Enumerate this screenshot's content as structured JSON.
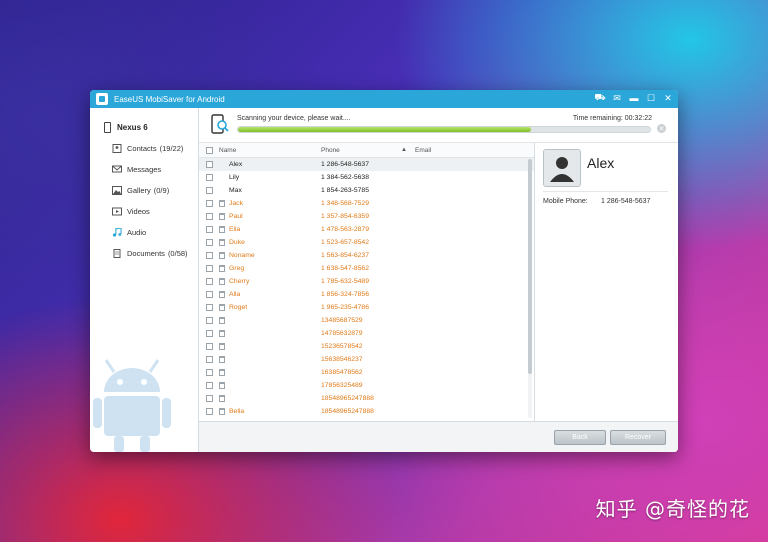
{
  "window": {
    "title": "EaseUS MobiSaver for Android"
  },
  "sidebar": {
    "device": "Nexus 6",
    "items": [
      {
        "label": "Contacts",
        "count": "(19/22)",
        "icon": "contacts-icon"
      },
      {
        "label": "Messages",
        "count": "",
        "icon": "messages-icon"
      },
      {
        "label": "Gallery",
        "count": "(0/9)",
        "icon": "gallery-icon"
      },
      {
        "label": "Videos",
        "count": "",
        "icon": "videos-icon"
      },
      {
        "label": "Audio",
        "count": "",
        "icon": "audio-icon"
      },
      {
        "label": "Documents",
        "count": "(0/58)",
        "icon": "documents-icon"
      }
    ]
  },
  "scan": {
    "status": "Scanning your device, please wait....",
    "remaining_label": "Time remaining: 00:32:22",
    "progress_percent": 71
  },
  "table": {
    "headers": {
      "name": "Name",
      "phone": "Phone",
      "email": "Email"
    },
    "rows": [
      {
        "name": "Alex",
        "phone": "1 286-548-5637",
        "deleted": false,
        "selected": true
      },
      {
        "name": "Lily",
        "phone": "1 384-562-5638",
        "deleted": false
      },
      {
        "name": "Max",
        "phone": "1 854-263-5785",
        "deleted": false
      },
      {
        "name": "Jack",
        "phone": "1 348-568-7529",
        "deleted": true
      },
      {
        "name": "Paul",
        "phone": "1 357-854-6359",
        "deleted": true
      },
      {
        "name": "Ella",
        "phone": "1 478-563-2879",
        "deleted": true
      },
      {
        "name": "Duke",
        "phone": "1 523-657-8542",
        "deleted": true
      },
      {
        "name": "Noname",
        "phone": "1 563-854-6237",
        "deleted": true
      },
      {
        "name": "Greg",
        "phone": "1 638-547-8562",
        "deleted": true
      },
      {
        "name": "Cherry",
        "phone": "1 785-632-5489",
        "deleted": true
      },
      {
        "name": "Alla",
        "phone": "1 856-324-7856",
        "deleted": true
      },
      {
        "name": "Roget",
        "phone": "1 965-235-4786",
        "deleted": true
      },
      {
        "name": "",
        "phone": "13485687529",
        "deleted": true
      },
      {
        "name": "",
        "phone": "14785632879",
        "deleted": true
      },
      {
        "name": "",
        "phone": "15236578542",
        "deleted": true
      },
      {
        "name": "",
        "phone": "15638546237",
        "deleted": true
      },
      {
        "name": "",
        "phone": "16385478562",
        "deleted": true
      },
      {
        "name": "",
        "phone": "17856325489",
        "deleted": true
      },
      {
        "name": "",
        "phone": "18548965247888",
        "deleted": true
      },
      {
        "name": "Bella",
        "phone": "18548965247888",
        "deleted": true
      }
    ]
  },
  "detail": {
    "name": "Alex",
    "phone_label": "Mobile Phone:",
    "phone_value": "1 286-548-5637"
  },
  "footer": {
    "back_label": "Back",
    "recover_label": "Recover"
  },
  "watermark": "知乎 @奇怪的花",
  "colors": {
    "accent": "#2aa6d8",
    "deleted_text": "#e07a18",
    "progress": "#8cc832"
  }
}
